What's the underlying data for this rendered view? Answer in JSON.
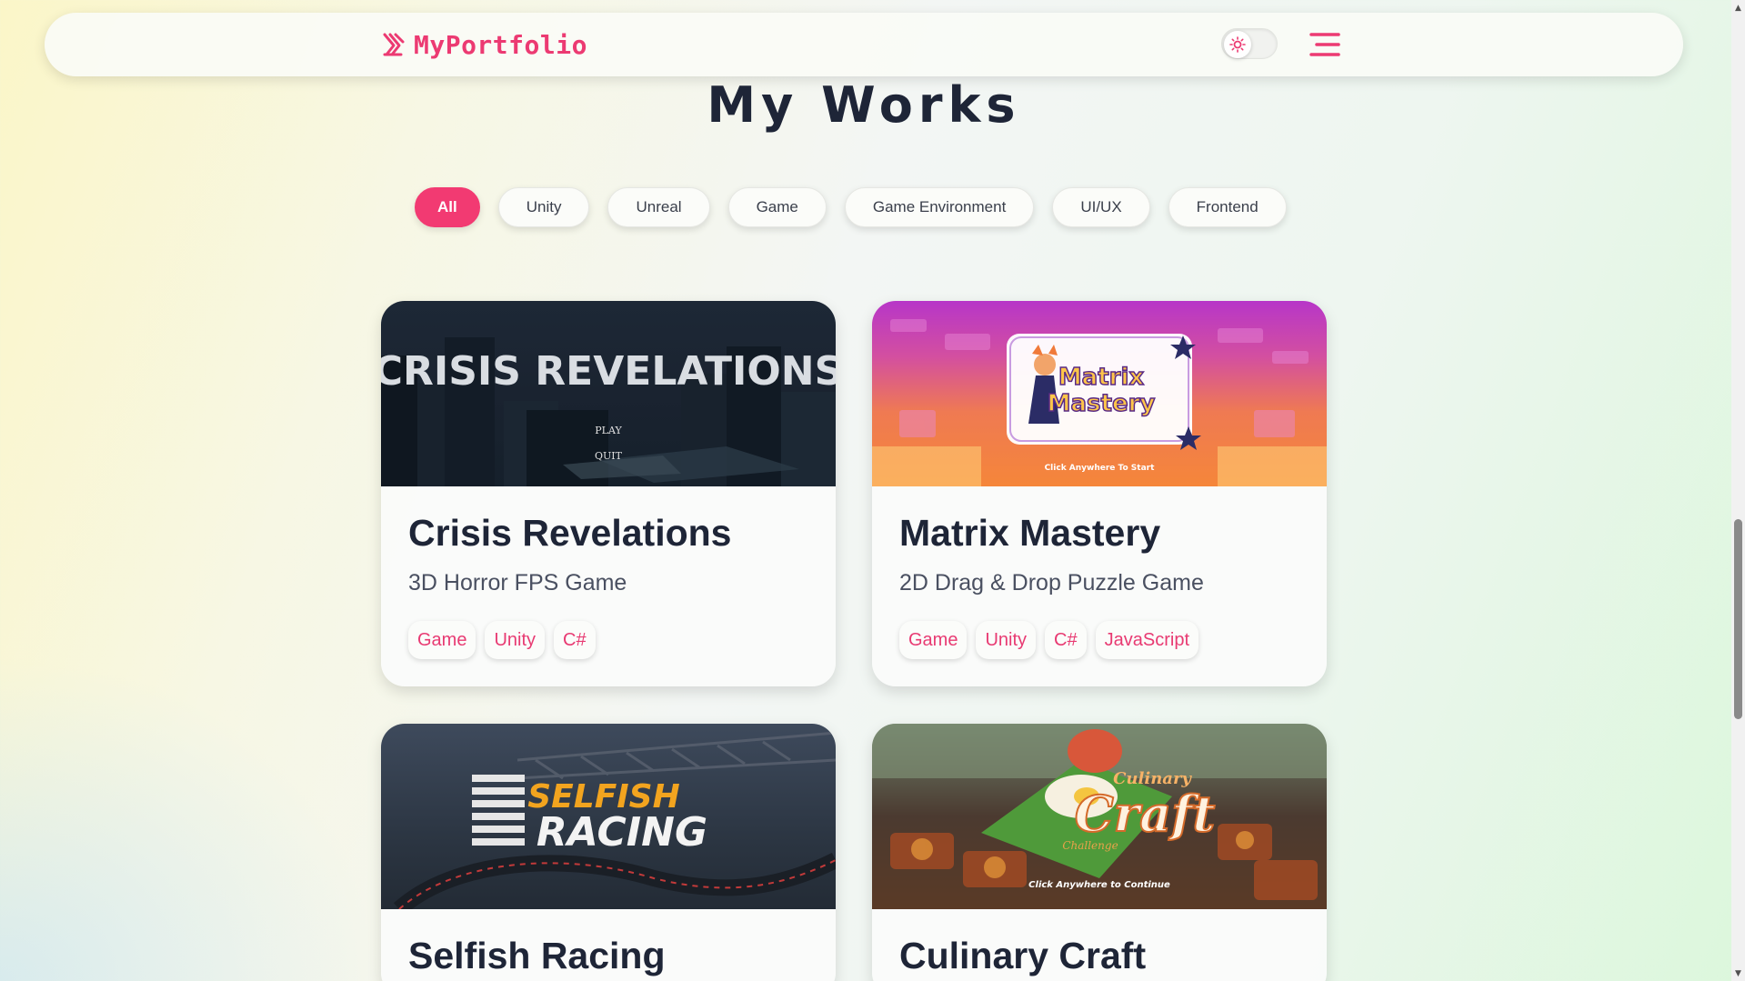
{
  "navbar": {
    "logo_text": "MyPortfolio",
    "logo_icon": "brand-logo-icon",
    "theme_toggle_icon": "sun-icon",
    "menu_icon": "hamburger-menu-icon",
    "accent_color": "#f23a72"
  },
  "section": {
    "title": "My Works"
  },
  "filters": {
    "items": [
      "All",
      "Unity",
      "Unreal",
      "Game",
      "Game Environment",
      "UI/UX",
      "Frontend"
    ],
    "active": "All"
  },
  "projects": [
    {
      "title": "Crisis Revelations",
      "subtitle": "3D Horror FPS Game",
      "tags": [
        "Game",
        "Unity",
        "C#"
      ],
      "image_text": {
        "heading": "CRISIS REVELATIONS",
        "play": "PLAY",
        "quit": "QUIT"
      }
    },
    {
      "title": "Matrix Mastery",
      "subtitle": "2D Drag & Drop Puzzle Game",
      "tags": [
        "Game",
        "Unity",
        "C#",
        "JavaScript"
      ],
      "image_text": {
        "line1": "Matrix",
        "line2": "Mastery",
        "caption": "Click Anywhere To Start"
      }
    },
    {
      "title": "Selfish Racing",
      "image_text": {
        "line1": "SELFISH",
        "line2": "RACING"
      }
    },
    {
      "title": "Culinary Craft",
      "image_text": {
        "line1": "Culinary",
        "line2": "Craft",
        "line3": "Challenge",
        "caption": "Click Anywhere to Continue"
      }
    }
  ],
  "scrollbar": {
    "up_icon": "scroll-up-arrow-icon",
    "down_icon": "scroll-down-arrow-icon"
  }
}
